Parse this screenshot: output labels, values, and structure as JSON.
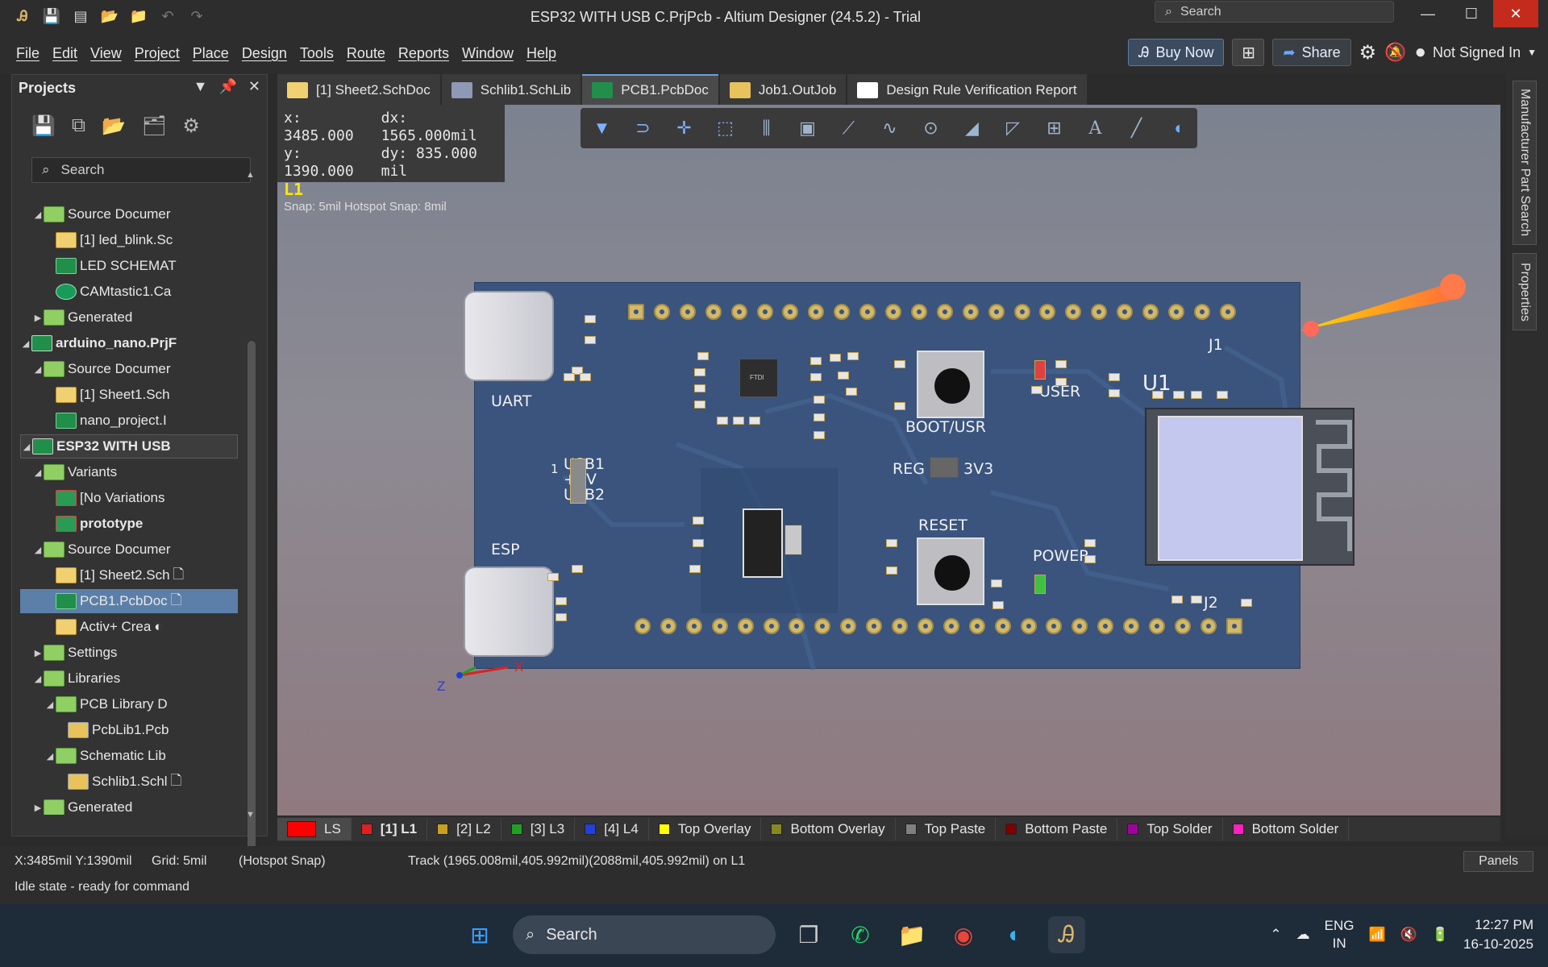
{
  "window": {
    "title": "ESP32 WITH USB C.PrjPcb - Altium Designer (24.5.2) - Trial",
    "search_placeholder": "Search",
    "minimize": "—",
    "maximize": "☐",
    "close": "✕"
  },
  "menu": [
    "File",
    "Edit",
    "View",
    "Project",
    "Place",
    "Design",
    "Tools",
    "Route",
    "Reports",
    "Window",
    "Help"
  ],
  "menu_right": {
    "buy_now": "Buy Now",
    "share": "Share",
    "user": "Not Signed In"
  },
  "projects_panel": {
    "title": "Projects",
    "search_placeholder": "Search",
    "tree": [
      {
        "label": "Source Documer",
        "icon": "folder",
        "indent": 2,
        "twisty": "◢"
      },
      {
        "label": "[1] led_blink.Sc",
        "icon": "sch",
        "indent": 3
      },
      {
        "label": "LED SCHEMAT",
        "icon": "pcb",
        "indent": 3
      },
      {
        "label": "CAMtastic1.Ca",
        "icon": "cam",
        "indent": 3
      },
      {
        "label": "Generated",
        "icon": "folder",
        "indent": 2,
        "twisty": "▶"
      },
      {
        "label": "arduino_nano.PrjF",
        "icon": "prj",
        "indent": 1,
        "twisty": "◢",
        "bold": true
      },
      {
        "label": "Source Documer",
        "icon": "folder",
        "indent": 2,
        "twisty": "◢"
      },
      {
        "label": "[1] Sheet1.Sch",
        "icon": "sch",
        "indent": 3
      },
      {
        "label": "nano_project.I",
        "icon": "pcb",
        "indent": 3
      },
      {
        "label": "ESP32 WITH USB",
        "icon": "prj",
        "indent": 1,
        "twisty": "◢",
        "bold": true,
        "state": "focused"
      },
      {
        "label": "Variants",
        "icon": "folder",
        "indent": 2,
        "twisty": "◢"
      },
      {
        "label": "[No Variations",
        "icon": "var",
        "indent": 3
      },
      {
        "label": "prototype",
        "icon": "var",
        "indent": 3,
        "bold": true
      },
      {
        "label": "Source Documer",
        "icon": "folder",
        "indent": 2,
        "twisty": "◢"
      },
      {
        "label": "[1] Sheet2.Sch",
        "icon": "sch",
        "indent": 3,
        "badge": "🗋"
      },
      {
        "label": "PCB1.PcbDoc",
        "icon": "pcb",
        "indent": 3,
        "badge": "🗋",
        "state": "selected"
      },
      {
        "label": "Activ+ Crea",
        "icon": "sch",
        "indent": 3,
        "badge": "◐"
      },
      {
        "label": "Settings",
        "icon": "folder",
        "indent": 2,
        "twisty": "▶"
      },
      {
        "label": "Libraries",
        "icon": "folder",
        "indent": 2,
        "twisty": "◢"
      },
      {
        "label": "PCB Library D",
        "icon": "folder",
        "indent": 3,
        "twisty": "◢"
      },
      {
        "label": "PcbLib1.Pcb",
        "icon": "lib",
        "indent": 4
      },
      {
        "label": "Schematic Lib",
        "icon": "folder",
        "indent": 3,
        "twisty": "◢"
      },
      {
        "label": "Schlib1.Schl",
        "icon": "lib",
        "indent": 4,
        "badge": "🗋"
      },
      {
        "label": "Generated",
        "icon": "folder",
        "indent": 2,
        "twisty": "▶"
      }
    ]
  },
  "doc_tabs": [
    {
      "label": "[1] Sheet2.SchDoc",
      "icon": "sch"
    },
    {
      "label": "Schlib1.SchLib",
      "icon": "lib"
    },
    {
      "label": "PCB1.PcbDoc",
      "icon": "pcb",
      "active": true
    },
    {
      "label": "Job1.OutJob",
      "icon": "job"
    },
    {
      "label": "Design Rule Verification Report",
      "icon": "rep"
    }
  ],
  "coords": {
    "x": "x:  3485.000",
    "dx": "dx:  1565.000mil",
    "y": "y:  1390.000",
    "dy": "dy:   835.000 mil",
    "layer": "L1",
    "snap": "Snap: 5mil Hotspot Snap: 8mil"
  },
  "board": {
    "silk": {
      "uart": "UART",
      "esp": "ESP",
      "usb1": "USB1",
      "plus5v": "+5V",
      "usb2": "USB2",
      "pin1": "1",
      "boot": "BOOT/USR",
      "user": "USER",
      "reg": "REG",
      "v3": "3V3",
      "reset": "RESET",
      "power": "POWER",
      "j1": "J1",
      "j2": "J2",
      "u1": "U1",
      "ftdi": "FTDI",
      "axis_z": "Z",
      "axis_x": "X"
    }
  },
  "layers": [
    {
      "label": "LS",
      "color": "#ff0000"
    },
    {
      "label": "[1] L1",
      "color": "#e02020",
      "bold": true
    },
    {
      "label": "[2] L2",
      "color": "#c8a020"
    },
    {
      "label": "[3] L3",
      "color": "#20a020"
    },
    {
      "label": "[4] L4",
      "color": "#2040e0"
    },
    {
      "label": "Top Overlay",
      "color": "#ffff00"
    },
    {
      "label": "Bottom Overlay",
      "color": "#888820"
    },
    {
      "label": "Top Paste",
      "color": "#808080"
    },
    {
      "label": "Bottom Paste",
      "color": "#800000"
    },
    {
      "label": "Top Solder",
      "color": "#a000a0"
    },
    {
      "label": "Bottom Solder",
      "color": "#ff20c0"
    }
  ],
  "right_panels": [
    "Manufacturer Part Search",
    "Properties"
  ],
  "status": {
    "pos": "X:3485mil Y:1390mil",
    "grid": "Grid: 5mil",
    "snap": "(Hotspot Snap)",
    "track": "Track (1965.008mil,405.992mil)(2088mil,405.992mil) on L1",
    "state": "Idle state - ready for command",
    "panels": "Panels"
  },
  "taskbar": {
    "search": "Search",
    "lang1": "ENG",
    "lang2": "IN",
    "time": "12:27 PM",
    "date": "16-10-2025"
  }
}
